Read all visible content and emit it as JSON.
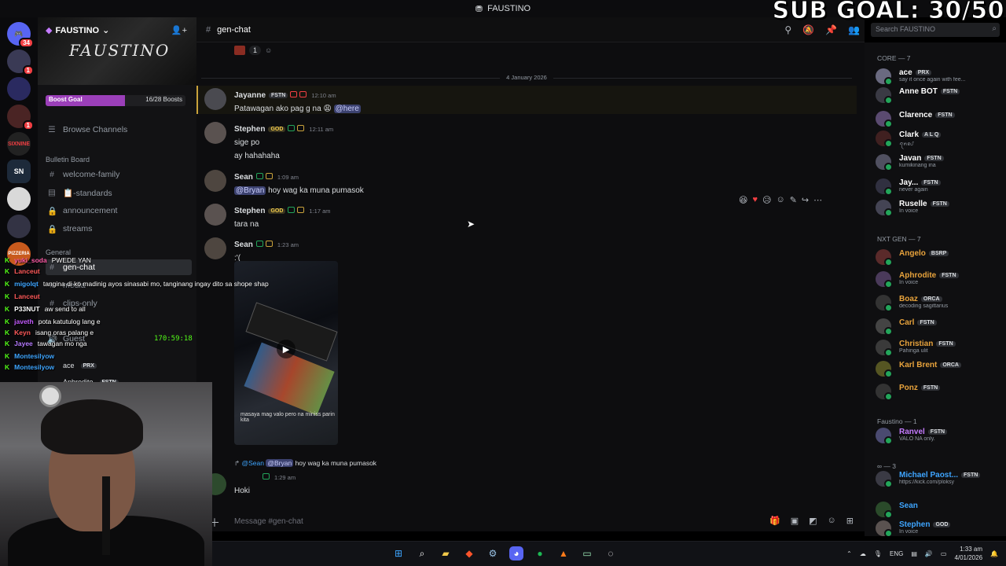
{
  "window": {
    "title": "FAUSTINO"
  },
  "stream_overlay": {
    "sub_goal": "SUB GOAL: 30/50",
    "clock": "170:59:18",
    "chat": [
      {
        "user": "yuki_soda",
        "text": "PWEDE YAN",
        "color": "#ff5ca8"
      },
      {
        "user": "Lanceut",
        "text": "",
        "color": "#ff5a5a"
      },
      {
        "user": "migolqt",
        "text": "tangina di ko madinig ayos sinasabi mo, tanginang ingay dito sa shope shap",
        "color": "#3ea5ff"
      },
      {
        "user": "Lanceut",
        "text": "",
        "color": "#ff5a5a"
      },
      {
        "user": "P33NUT",
        "text": "aw send to all",
        "color": "#ffffff"
      },
      {
        "user": "javeth",
        "text": "pota katutulog lang e",
        "color": "#c45cff"
      },
      {
        "user": "Keyn",
        "text": "isang oras palang e",
        "color": "#ff5a5a"
      },
      {
        "user": "Jayee",
        "text": "tawagan mo nga",
        "color": "#b57aff"
      },
      {
        "user": "Montesilyow",
        "text": "",
        "color": "#3ea5ff"
      },
      {
        "user": "Montesilyow",
        "text": "",
        "color": "#3ea5ff"
      }
    ]
  },
  "server": {
    "name": "FAUSTINO",
    "banner_logo": "FAUSTINO",
    "boost_label": "Boost Goal",
    "boost_count": "16/28 Boosts",
    "boost_progress": 0.57,
    "browse": "Browse Channels",
    "categories": [
      {
        "name": "Bulletin Board"
      },
      {
        "name": "General"
      }
    ],
    "channels": [
      {
        "name": "welcome-family",
        "icon": "#"
      },
      {
        "name": "📋-standards",
        "icon": "▤"
      },
      {
        "name": "announcement",
        "icon": "🔒"
      },
      {
        "name": "streams",
        "icon": "🔒"
      },
      {
        "name": "gen-chat",
        "icon": "#"
      },
      {
        "name": "media",
        "icon": "#"
      },
      {
        "name": "clips-only",
        "icon": "#"
      },
      {
        "name": "Guest",
        "icon": "🔊"
      }
    ],
    "voice_users": [
      {
        "name": "ace",
        "tag": "PRX"
      },
      {
        "name": "Aphrodite",
        "tag": "FSTN"
      }
    ]
  },
  "rail": {
    "badges": [
      "34",
      "1",
      "",
      "1",
      "",
      "",
      "",
      "",
      "",
      ""
    ],
    "labels": [
      "",
      "",
      "",
      "",
      "SIXNINE",
      "SN",
      "",
      "",
      "PIZZERIA",
      ""
    ]
  },
  "channel": {
    "name": "gen-chat",
    "composer_placeholder": "Message #gen-chat"
  },
  "search": {
    "placeholder": "Search FAUSTINO"
  },
  "chat": {
    "reaction_count": "1",
    "date_divider": "4 January 2026",
    "messages": [
      {
        "user": "Jayanne",
        "color": "#ffffff",
        "tag": "FSTN",
        "time": "12:10 am",
        "lines": [
          "Patawagan ako pag g na 😩"
        ],
        "mention": "@here"
      },
      {
        "user": "Stephen",
        "color": "#3ea5ff",
        "tag": "GOD",
        "time": "12:11 am",
        "lines": [
          "sige po",
          "ay hahahaha"
        ]
      },
      {
        "user": "Sean",
        "color": "#3ea5ff",
        "tag": "",
        "time": "1:09 am",
        "mention": "@Bryan",
        "lines": [
          "hoy wag ka muna pumasok"
        ]
      },
      {
        "user": "Stephen",
        "color": "#3ea5ff",
        "tag": "GOD",
        "time": "1:17 am",
        "lines": [
          "tara na"
        ]
      },
      {
        "user": "Sean",
        "color": "#3ea5ff",
        "tag": "",
        "time": "1:23 am",
        "lines": [
          ":'("
        ]
      }
    ],
    "video_caption": "masaya mag valo pero na miniss parin kita",
    "reply": {
      "ref_user": "@Sean",
      "ref_mention": "@Bryan",
      "ref_text": "hoy wag ka muna pumasok",
      "time": "1:29 am",
      "text": "Hoki"
    }
  },
  "members": {
    "groups": [
      {
        "title": "CORE — 7"
      },
      {
        "title": "NXT GEN — 7"
      },
      {
        "title": "Faustino — 1"
      },
      {
        "title": "∞ — 3"
      }
    ],
    "list": [
      {
        "name": "ace",
        "tag": "PRX",
        "status": "say it once again with fee...",
        "color": "#ffffff"
      },
      {
        "name": "Anne BOT",
        "tag": "FSTN",
        "status": "",
        "color": "#ffffff"
      },
      {
        "name": "Clarence",
        "tag": "FSTN",
        "status": "",
        "color": "#ffffff"
      },
      {
        "name": "Clark",
        "tag": "A L Q",
        "status": "ꪖꪀꫀᦔ",
        "color": "#ffffff"
      },
      {
        "name": "Javan",
        "tag": "FSTN",
        "status": "kumikinang ina",
        "color": "#ffffff"
      },
      {
        "name": "Jay...",
        "tag": "FSTN",
        "status": "never again",
        "color": "#ffffff"
      },
      {
        "name": "Ruselle",
        "tag": "FSTN",
        "status": "In voice",
        "color": "#ffffff"
      },
      {
        "name": "Angelo",
        "tag": "BSRP",
        "status": "",
        "color": "#e8a33c"
      },
      {
        "name": "Aphrodite",
        "tag": "FSTN",
        "status": "In voice",
        "color": "#e8a33c"
      },
      {
        "name": "Boaz",
        "tag": "ORCA",
        "status": "decoding sagittarius",
        "color": "#e8a33c"
      },
      {
        "name": "Carl",
        "tag": "FSTN",
        "status": "",
        "color": "#e8a33c"
      },
      {
        "name": "Christian",
        "tag": "FSTN",
        "status": "Pahinga ulit",
        "color": "#e8a33c"
      },
      {
        "name": "Karl Brent",
        "tag": "ORCA",
        "status": "",
        "color": "#e8a33c"
      },
      {
        "name": "Ponz",
        "tag": "FSTN",
        "status": "",
        "color": "#e8a33c"
      },
      {
        "name": "Ranvel",
        "tag": "FSTN",
        "status": "VALO NA only.",
        "color": "#c47bff"
      },
      {
        "name": "Michael Paost...",
        "tag": "FSTN",
        "status": "https://kick.com/ploksy",
        "color": "#3ea5ff"
      },
      {
        "name": "Sean",
        "tag": "",
        "status": "",
        "color": "#3ea5ff"
      },
      {
        "name": "Stephen",
        "tag": "GOD",
        "status": "In voice",
        "color": "#3ea5ff"
      }
    ]
  },
  "taskbar": {
    "lang": "ENG",
    "time": "1:33 am",
    "date": "4/01/2026"
  }
}
